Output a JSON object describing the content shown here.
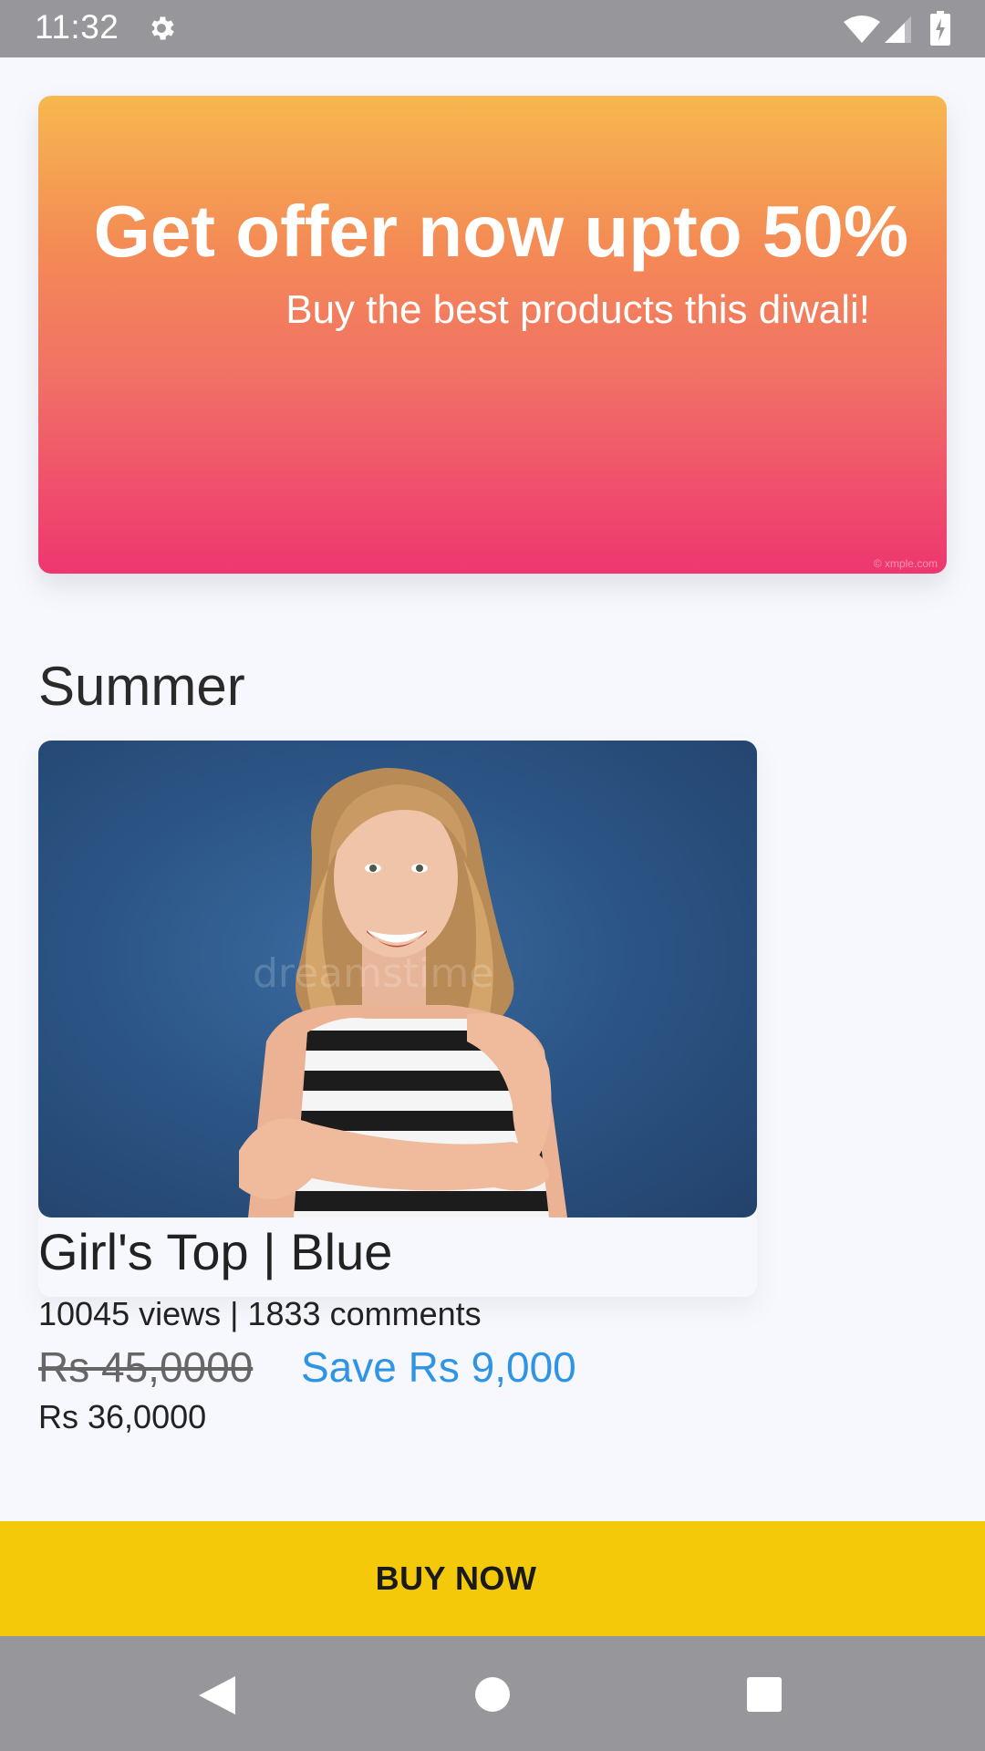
{
  "status_bar": {
    "time": "11:32",
    "icons": [
      "gear-icon",
      "wifi-icon",
      "signal-icon",
      "battery-charging-icon"
    ]
  },
  "banner": {
    "title": "Get offer now upto 50%",
    "subtitle": "Buy the best products this diwali!",
    "watermark": "© xmple.com",
    "colors": [
      "#f6b84f",
      "#f17265",
      "#ee3670"
    ]
  },
  "section": {
    "title": "Summer"
  },
  "product": {
    "name": "Girl's Top | Blue",
    "stats": "10045 views | 1833 comments",
    "original_price": "Rs 45,0000",
    "save_label": "Save Rs 9,000",
    "final_price": "Rs 36,0000",
    "image_watermark": "dreamstime"
  },
  "cta": {
    "label": "BUY NOW",
    "color": "#f3c90a"
  },
  "nav_bar": {
    "icons": [
      "back-icon",
      "home-icon",
      "recents-icon"
    ]
  }
}
